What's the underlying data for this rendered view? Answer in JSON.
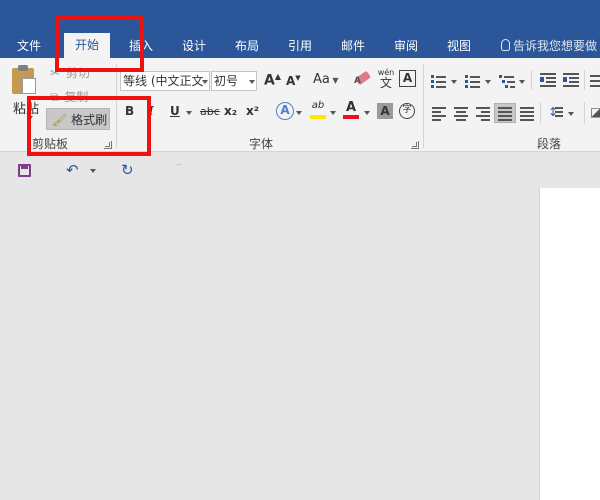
{
  "tabs": [
    "文件",
    "开始",
    "插入",
    "设计",
    "布局",
    "引用",
    "邮件",
    "审阅",
    "视图"
  ],
  "active_tab": "开始",
  "tell_me": "告诉我您想要做",
  "clipboard": {
    "paste": "粘贴",
    "cut": "剪切",
    "copy": "复制",
    "format_painter": "格式刷",
    "group_label": "剪贴板"
  },
  "font": {
    "font_name": "等线 (中文正文",
    "font_size": "初号",
    "grow": "A",
    "shrink": "A",
    "change_case": "Aa",
    "phonetic_top": "wén",
    "phonetic_bottom": "文",
    "char_border": "A",
    "bold": "B",
    "italic": "I",
    "underline": "U",
    "strike": "abc",
    "subscript": "x₂",
    "superscript": "x²",
    "text_effect": "A",
    "highlight": "ab",
    "font_color": "A",
    "char_shading": "A",
    "enclose": "字",
    "group_label": "字体"
  },
  "paragraph": {
    "group_label": "段落"
  },
  "colors": {
    "ribbon_blue": "#2b579a",
    "highlight_red": "#ee1111",
    "highlight_yellow": "#ffe600",
    "font_color_red": "#e81123"
  }
}
